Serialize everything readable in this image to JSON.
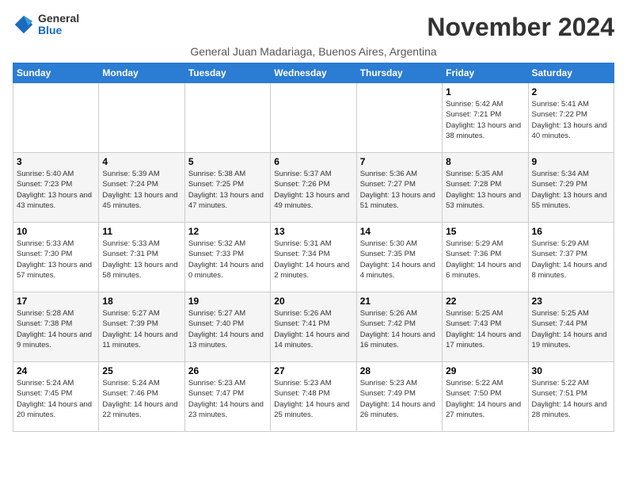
{
  "logo": {
    "general": "General",
    "blue": "Blue"
  },
  "header": {
    "month_title": "November 2024",
    "subtitle": "General Juan Madariaga, Buenos Aires, Argentina"
  },
  "weekdays": [
    "Sunday",
    "Monday",
    "Tuesday",
    "Wednesday",
    "Thursday",
    "Friday",
    "Saturday"
  ],
  "weeks": [
    [
      {
        "day": "",
        "info": ""
      },
      {
        "day": "",
        "info": ""
      },
      {
        "day": "",
        "info": ""
      },
      {
        "day": "",
        "info": ""
      },
      {
        "day": "",
        "info": ""
      },
      {
        "day": "1",
        "info": "Sunrise: 5:42 AM\nSunset: 7:21 PM\nDaylight: 13 hours and 38 minutes."
      },
      {
        "day": "2",
        "info": "Sunrise: 5:41 AM\nSunset: 7:22 PM\nDaylight: 13 hours and 40 minutes."
      }
    ],
    [
      {
        "day": "3",
        "info": "Sunrise: 5:40 AM\nSunset: 7:23 PM\nDaylight: 13 hours and 43 minutes."
      },
      {
        "day": "4",
        "info": "Sunrise: 5:39 AM\nSunset: 7:24 PM\nDaylight: 13 hours and 45 minutes."
      },
      {
        "day": "5",
        "info": "Sunrise: 5:38 AM\nSunset: 7:25 PM\nDaylight: 13 hours and 47 minutes."
      },
      {
        "day": "6",
        "info": "Sunrise: 5:37 AM\nSunset: 7:26 PM\nDaylight: 13 hours and 49 minutes."
      },
      {
        "day": "7",
        "info": "Sunrise: 5:36 AM\nSunset: 7:27 PM\nDaylight: 13 hours and 51 minutes."
      },
      {
        "day": "8",
        "info": "Sunrise: 5:35 AM\nSunset: 7:28 PM\nDaylight: 13 hours and 53 minutes."
      },
      {
        "day": "9",
        "info": "Sunrise: 5:34 AM\nSunset: 7:29 PM\nDaylight: 13 hours and 55 minutes."
      }
    ],
    [
      {
        "day": "10",
        "info": "Sunrise: 5:33 AM\nSunset: 7:30 PM\nDaylight: 13 hours and 57 minutes."
      },
      {
        "day": "11",
        "info": "Sunrise: 5:33 AM\nSunset: 7:31 PM\nDaylight: 13 hours and 58 minutes."
      },
      {
        "day": "12",
        "info": "Sunrise: 5:32 AM\nSunset: 7:33 PM\nDaylight: 14 hours and 0 minutes."
      },
      {
        "day": "13",
        "info": "Sunrise: 5:31 AM\nSunset: 7:34 PM\nDaylight: 14 hours and 2 minutes."
      },
      {
        "day": "14",
        "info": "Sunrise: 5:30 AM\nSunset: 7:35 PM\nDaylight: 14 hours and 4 minutes."
      },
      {
        "day": "15",
        "info": "Sunrise: 5:29 AM\nSunset: 7:36 PM\nDaylight: 14 hours and 6 minutes."
      },
      {
        "day": "16",
        "info": "Sunrise: 5:29 AM\nSunset: 7:37 PM\nDaylight: 14 hours and 8 minutes."
      }
    ],
    [
      {
        "day": "17",
        "info": "Sunrise: 5:28 AM\nSunset: 7:38 PM\nDaylight: 14 hours and 9 minutes."
      },
      {
        "day": "18",
        "info": "Sunrise: 5:27 AM\nSunset: 7:39 PM\nDaylight: 14 hours and 11 minutes."
      },
      {
        "day": "19",
        "info": "Sunrise: 5:27 AM\nSunset: 7:40 PM\nDaylight: 14 hours and 13 minutes."
      },
      {
        "day": "20",
        "info": "Sunrise: 5:26 AM\nSunset: 7:41 PM\nDaylight: 14 hours and 14 minutes."
      },
      {
        "day": "21",
        "info": "Sunrise: 5:26 AM\nSunset: 7:42 PM\nDaylight: 14 hours and 16 minutes."
      },
      {
        "day": "22",
        "info": "Sunrise: 5:25 AM\nSunset: 7:43 PM\nDaylight: 14 hours and 17 minutes."
      },
      {
        "day": "23",
        "info": "Sunrise: 5:25 AM\nSunset: 7:44 PM\nDaylight: 14 hours and 19 minutes."
      }
    ],
    [
      {
        "day": "24",
        "info": "Sunrise: 5:24 AM\nSunset: 7:45 PM\nDaylight: 14 hours and 20 minutes."
      },
      {
        "day": "25",
        "info": "Sunrise: 5:24 AM\nSunset: 7:46 PM\nDaylight: 14 hours and 22 minutes."
      },
      {
        "day": "26",
        "info": "Sunrise: 5:23 AM\nSunset: 7:47 PM\nDaylight: 14 hours and 23 minutes."
      },
      {
        "day": "27",
        "info": "Sunrise: 5:23 AM\nSunset: 7:48 PM\nDaylight: 14 hours and 25 minutes."
      },
      {
        "day": "28",
        "info": "Sunrise: 5:23 AM\nSunset: 7:49 PM\nDaylight: 14 hours and 26 minutes."
      },
      {
        "day": "29",
        "info": "Sunrise: 5:22 AM\nSunset: 7:50 PM\nDaylight: 14 hours and 27 minutes."
      },
      {
        "day": "30",
        "info": "Sunrise: 5:22 AM\nSunset: 7:51 PM\nDaylight: 14 hours and 28 minutes."
      }
    ]
  ]
}
